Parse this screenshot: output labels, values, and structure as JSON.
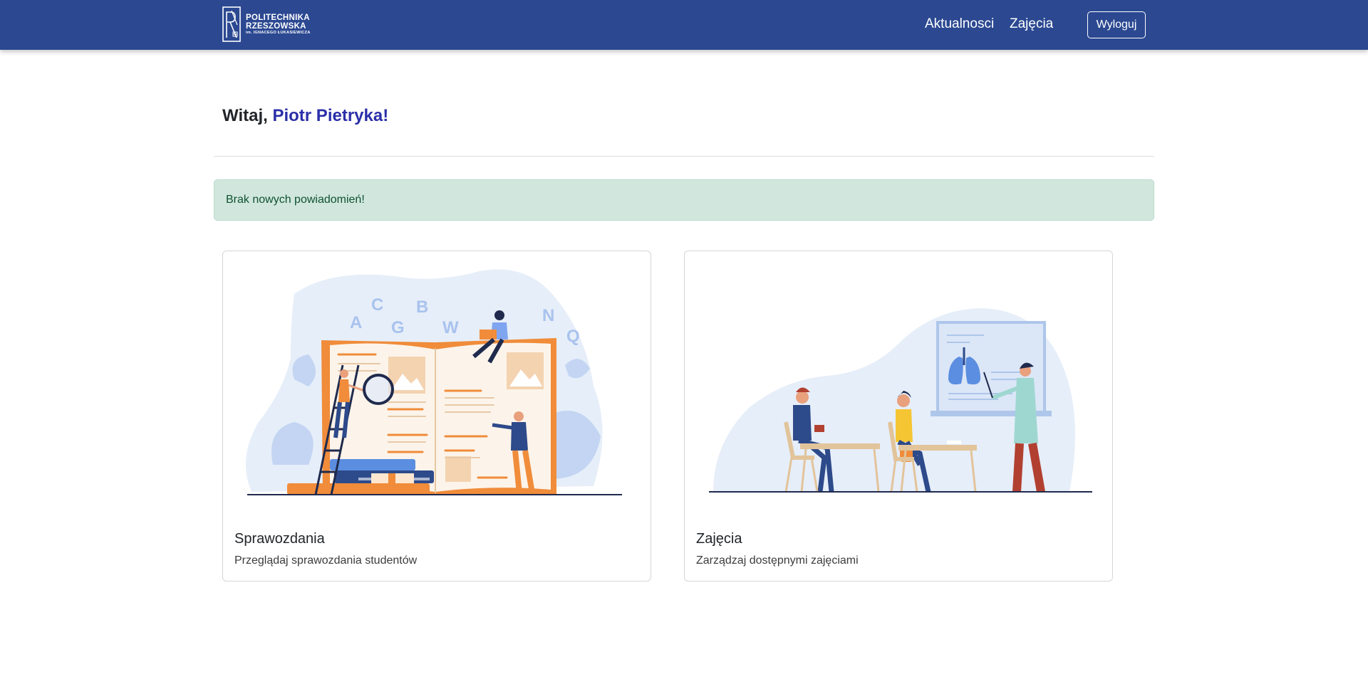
{
  "brand": {
    "line1": "POLITECHNIKA",
    "line2": "RZESZOWSKA",
    "line3": "im. IGNACEGO ŁUKASIEWICZA"
  },
  "nav": {
    "news_label": "Aktualnosci",
    "classes_label": "Zajęcia",
    "logout_label": "Wyloguj"
  },
  "greeting": {
    "prefix": "Witaj,",
    "user_name": "Piotr Pietryka!"
  },
  "alert": {
    "message": "Brak nowych powiadomień!"
  },
  "cards": [
    {
      "title": "Sprawozdania",
      "text": "Przeglądaj sprawozdania studentów",
      "illustration": "book-reading-illustration",
      "letters": [
        "A",
        "C",
        "G",
        "B",
        "W",
        "N",
        "Q"
      ]
    },
    {
      "title": "Zajęcia",
      "text": "Zarządzaj dostępnymi zajęciami",
      "illustration": "classroom-lecture-illustration"
    }
  ],
  "colors": {
    "navbar": "#2b4891",
    "accent_name": "#2b2fa8",
    "alert_bg": "#d1e7dd",
    "alert_text": "#0f5132"
  }
}
